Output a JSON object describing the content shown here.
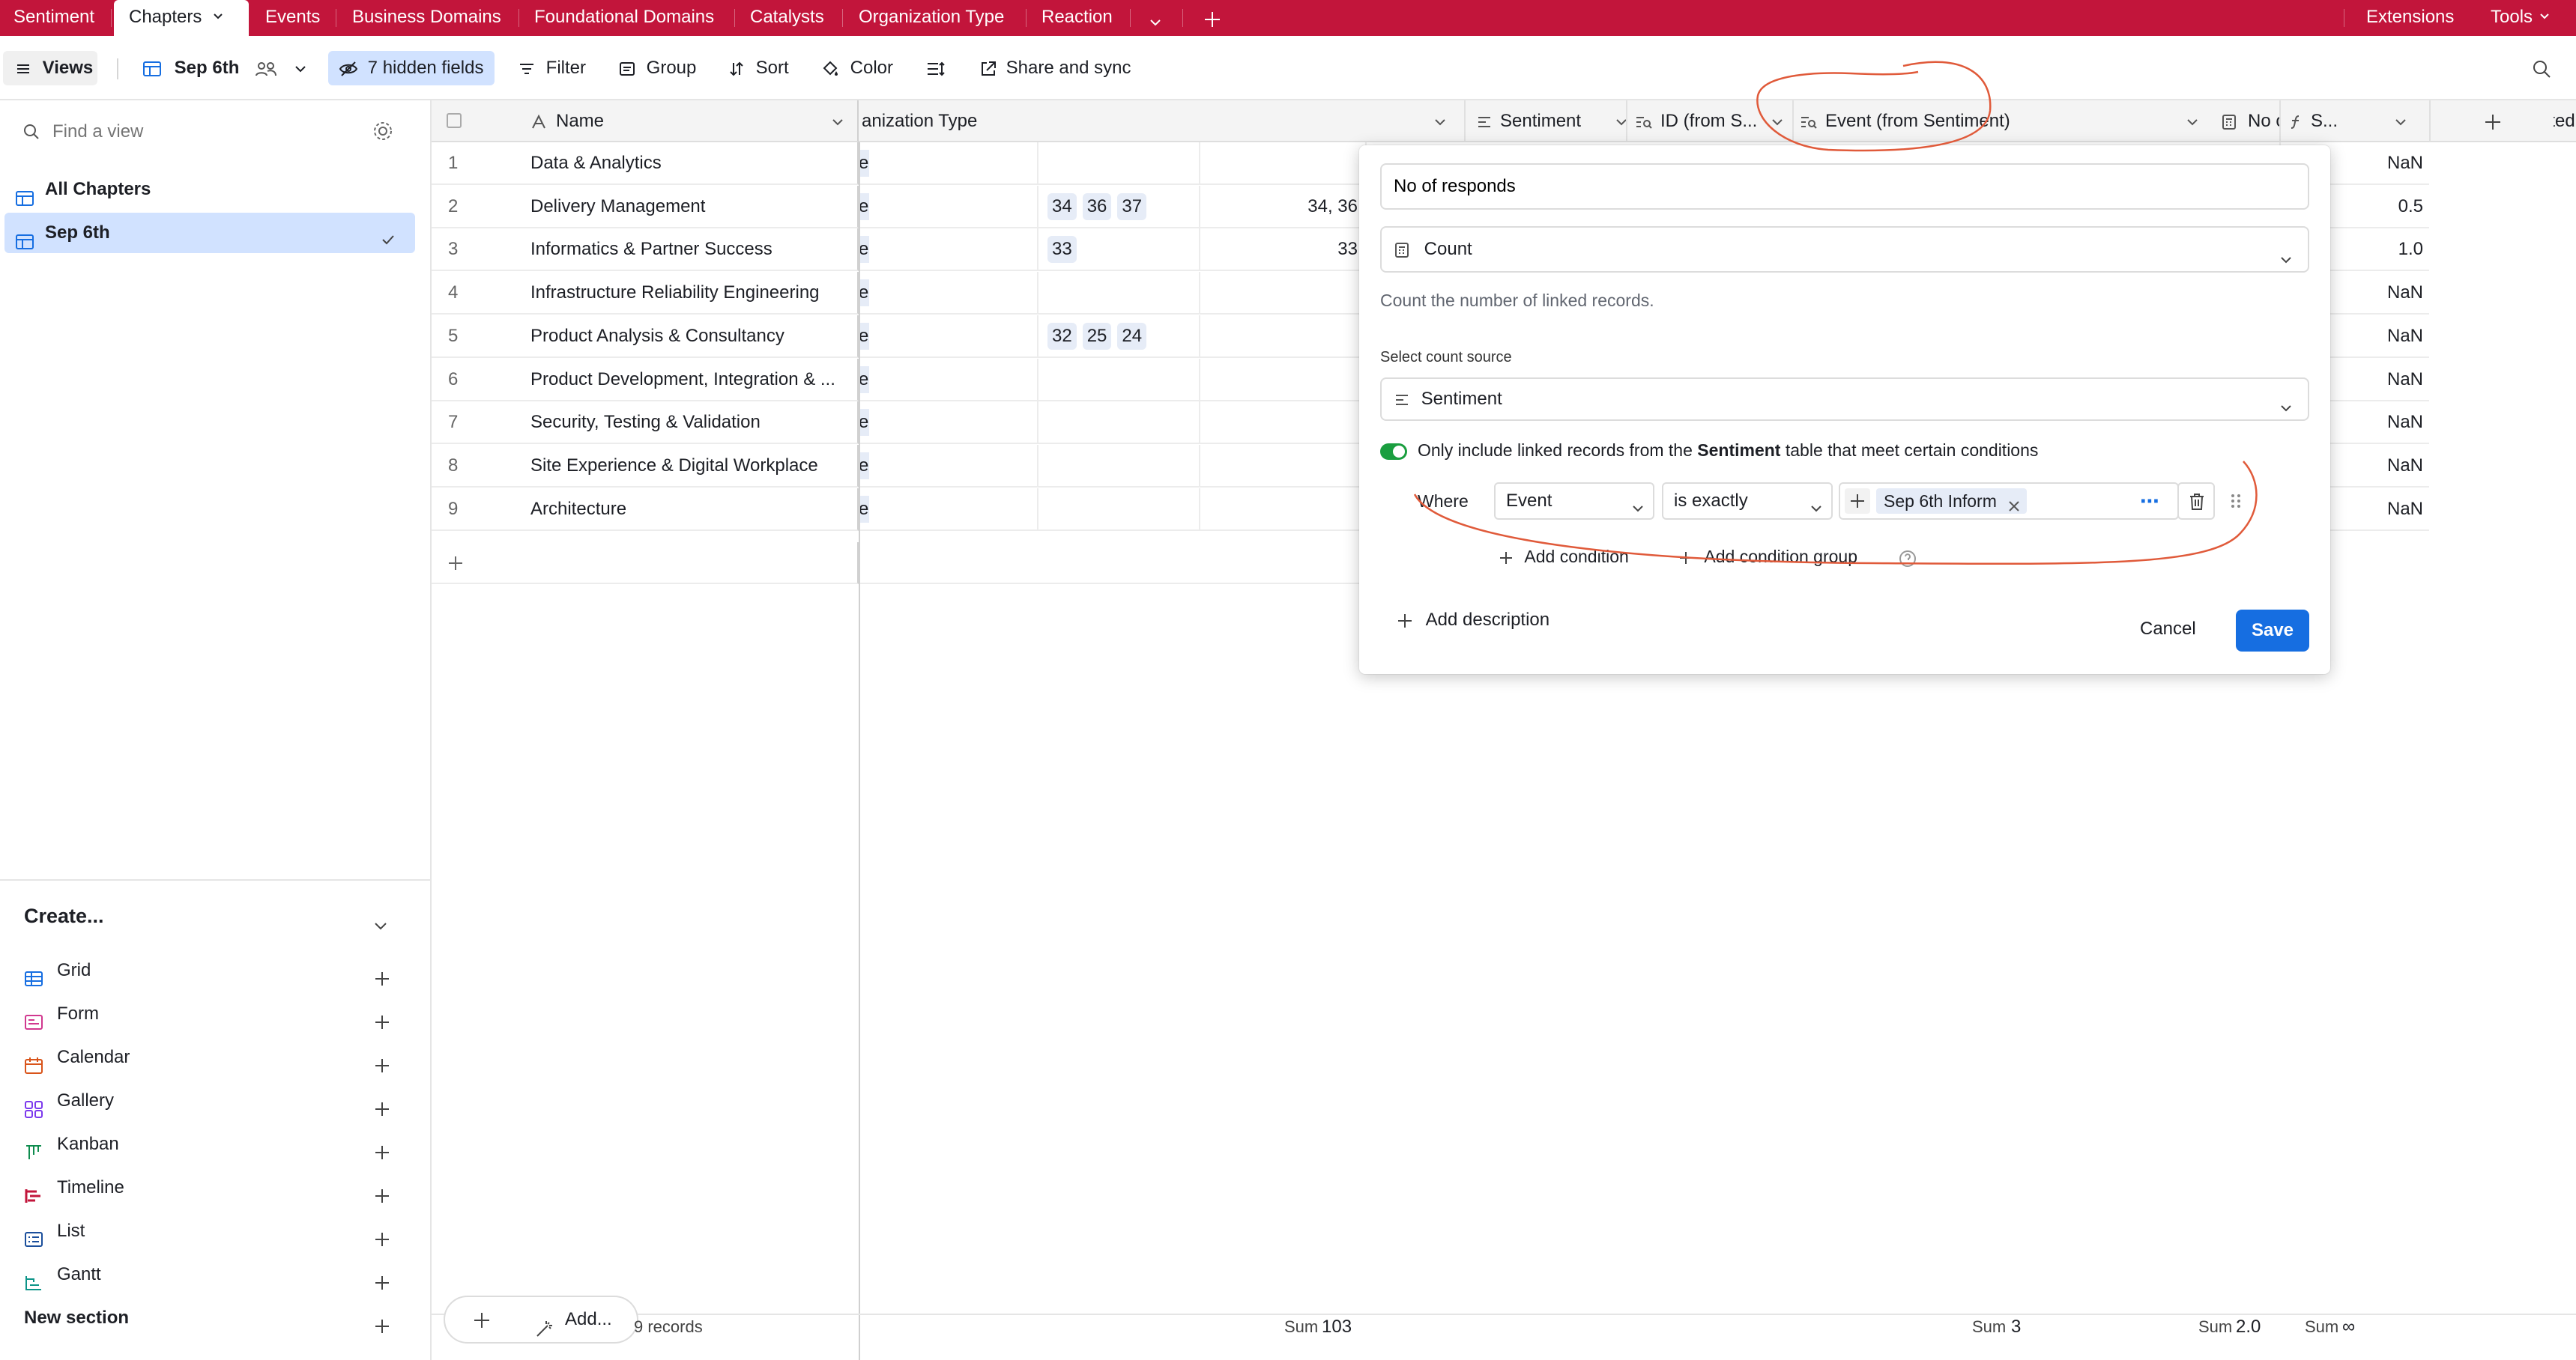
{
  "tabs": {
    "sentiment": "Sentiment",
    "chapters": "Chapters",
    "events": "Events",
    "business_domains": "Business Domains",
    "foundational_domains": "Foundational Domains",
    "catalysts": "Catalysts",
    "organization_type": "Organization Type",
    "reaction": "Reaction",
    "extensions": "Extensions",
    "tools": "Tools"
  },
  "toolbar": {
    "views": "Views",
    "view_name": "Sep 6th",
    "hidden_fields": "7 hidden fields",
    "filter": "Filter",
    "group": "Group",
    "sort": "Sort",
    "color": "Color",
    "share": "Share and sync"
  },
  "sidebar": {
    "find_placeholder": "Find a view",
    "views": [
      "All Chapters",
      "Sep 6th"
    ],
    "create_label": "Create...",
    "create_items": [
      "Grid",
      "Form",
      "Calendar",
      "Gallery",
      "Kanban",
      "Timeline",
      "List",
      "Gantt"
    ],
    "new_section": "New section"
  },
  "grid": {
    "headers": {
      "name": "Name",
      "org_type": "anization Type",
      "sentiment": "Sentiment",
      "id_from": "ID (from S...",
      "event_from": "Event (from Sentiment)",
      "no_of_responds": "No of responds",
      "supported": "Supported (Number)",
      "s": "S..."
    },
    "rows": [
      {
        "num": "1",
        "name": "Data & Analytics",
        "org": "er",
        "chips": [],
        "id": "",
        "last": "NaN"
      },
      {
        "num": "2",
        "name": "Delivery Management",
        "org": "er",
        "chips": [
          "34",
          "36",
          "37"
        ],
        "id": "34, 36",
        "last": "0.5"
      },
      {
        "num": "3",
        "name": "Informatics & Partner Success",
        "org": "er",
        "chips": [
          "33"
        ],
        "id": "33",
        "last": "1.0"
      },
      {
        "num": "4",
        "name": "Infrastructure Reliability Engineering",
        "org": "er",
        "chips": [],
        "id": "",
        "last": "NaN"
      },
      {
        "num": "5",
        "name": "Product Analysis & Consultancy",
        "org": "er",
        "chips": [
          "32",
          "25",
          "24"
        ],
        "id": "",
        "last": "NaN"
      },
      {
        "num": "6",
        "name": "Product Development, Integration & ...",
        "org": "er",
        "chips": [],
        "id": "",
        "last": "NaN"
      },
      {
        "num": "7",
        "name": "Security, Testing & Validation",
        "org": "er",
        "chips": [],
        "id": "",
        "last": "NaN"
      },
      {
        "num": "8",
        "name": "Site Experience & Digital Workplace",
        "org": "er",
        "chips": [],
        "id": "",
        "last": "NaN"
      },
      {
        "num": "9",
        "name": "Architecture",
        "org": "er",
        "chips": [],
        "id": "",
        "last": "NaN"
      }
    ],
    "footer": {
      "add": "Add...",
      "records": "9 records",
      "sum_label": "Sum",
      "sum_id": "103",
      "sum_responds": "3",
      "sum_supported": "2.0",
      "sum_s": "∞"
    }
  },
  "popup": {
    "field_name": "No of responds",
    "field_type": "Count",
    "description": "Count the number of linked records.",
    "source_label": "Select count source",
    "source_value": "Sentiment",
    "toggle_text_pre": "Only include linked records from the ",
    "toggle_text_bold": "Sentiment",
    "toggle_text_post": " table that meet certain conditions",
    "where": "Where",
    "condition_field": "Event",
    "condition_op": "is exactly",
    "condition_value": "Sep 6th Inform",
    "add_condition": "Add condition",
    "add_condition_group": "Add condition group",
    "add_description": "Add description",
    "cancel": "Cancel",
    "save": "Save"
  },
  "colors": {
    "brand": "#c2153b",
    "accent": "#166ee1",
    "toggle": "#1a9e3f",
    "annotation": "#e05a3a"
  }
}
